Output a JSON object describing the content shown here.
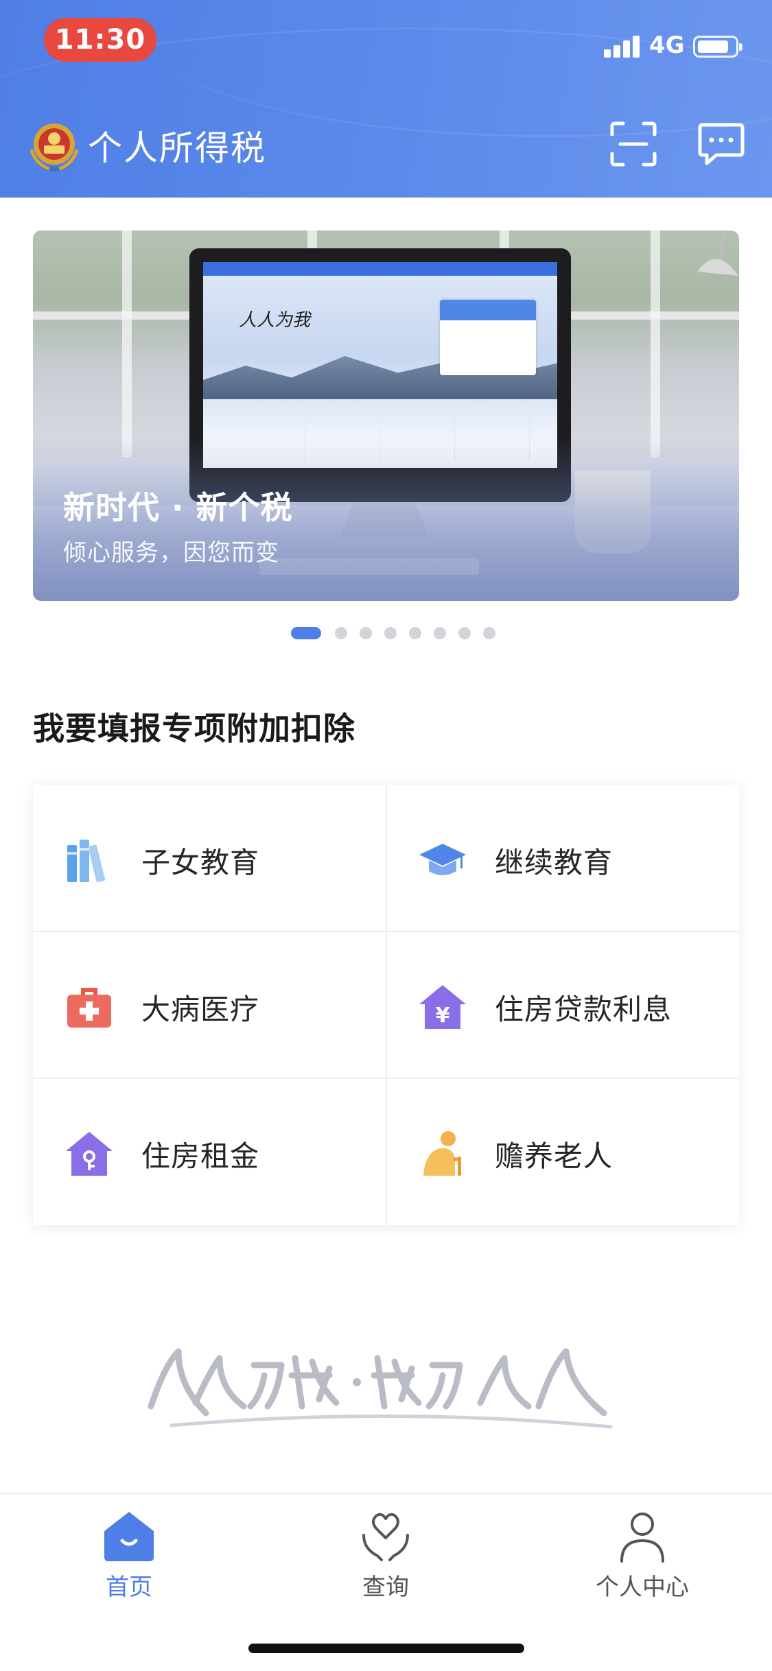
{
  "status": {
    "time": "11:30",
    "network": "4G"
  },
  "header": {
    "title": "个人所得税",
    "icons": {
      "logo": "tax-emblem-icon",
      "scan": "scan-icon",
      "message": "message-icon"
    }
  },
  "banner": {
    "title": "新时代 · 新个税",
    "subtitle": "倾心服务，因您而变",
    "page_count": 8,
    "active_index": 0
  },
  "deductions": {
    "title": "我要填报专项附加扣除",
    "items": [
      {
        "label": "子女教育",
        "icon": "books-icon",
        "color": "#5aa2ea"
      },
      {
        "label": "继续教育",
        "icon": "graduation-cap-icon",
        "color": "#4f86e8"
      },
      {
        "label": "大病医疗",
        "icon": "medical-kit-icon",
        "color": "#ec6a5e"
      },
      {
        "label": "住房贷款利息",
        "icon": "house-yuan-icon",
        "color": "#8a6ee8"
      },
      {
        "label": "住房租金",
        "icon": "house-key-icon",
        "color": "#8a6ee8"
      },
      {
        "label": "赡养老人",
        "icon": "elderly-icon",
        "color": "#f2b14a"
      }
    ]
  },
  "tabbar": {
    "items": [
      {
        "label": "首页",
        "icon": "home-icon",
        "active": true
      },
      {
        "label": "查询",
        "icon": "heart-hands-icon",
        "active": false
      },
      {
        "label": "个人中心",
        "icon": "person-icon",
        "active": false
      }
    ]
  },
  "colors": {
    "brand": "#4f7ee6",
    "header_gradient_end": "#6b97ee",
    "time_pill": "#e8483e"
  }
}
